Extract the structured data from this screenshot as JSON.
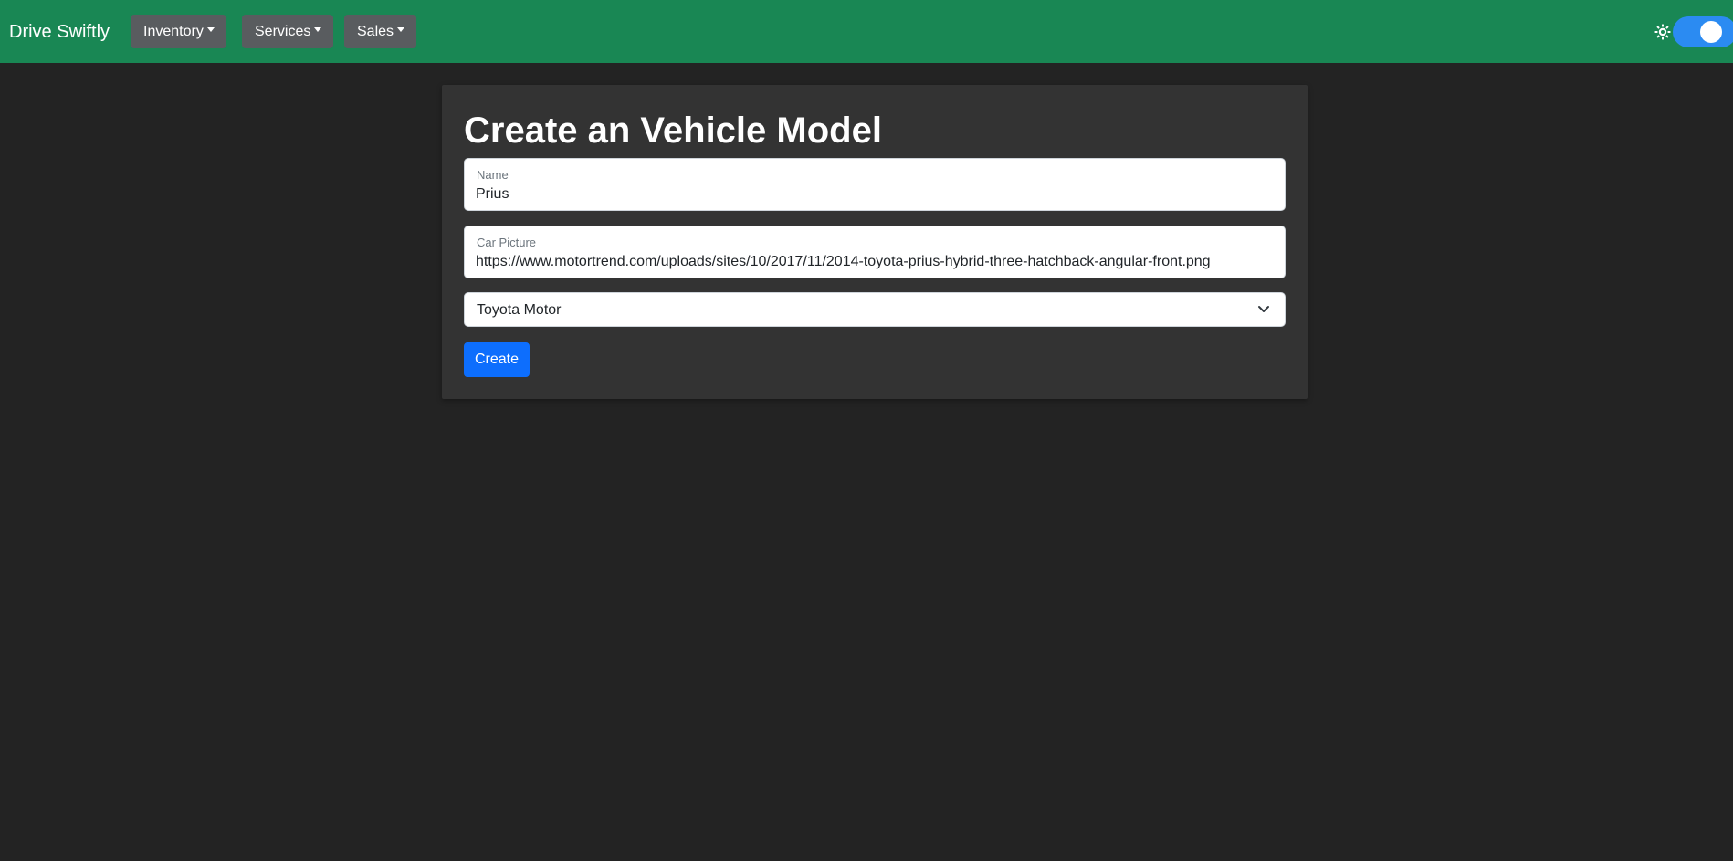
{
  "navbar": {
    "brand": "Drive Swiftly",
    "menus": [
      {
        "label": "Inventory"
      },
      {
        "label": "Services"
      },
      {
        "label": "Sales"
      }
    ],
    "theme_toggle": {
      "icon": "sun-icon",
      "on": true
    }
  },
  "form": {
    "title": "Create an Vehicle Model",
    "name": {
      "label": "Name",
      "value": "Prius"
    },
    "picture": {
      "label": "Car Picture",
      "value": "https://www.motortrend.com/uploads/sites/10/2017/11/2014-toyota-prius-hybrid-three-hatchback-angular-front.png"
    },
    "manufacturer": {
      "selected": "Toyota Motor"
    },
    "submit_label": "Create"
  },
  "colors": {
    "navbar": "#198754",
    "background": "#232323",
    "card": "#333333",
    "primary": "#0d6efd",
    "nav_button": "#595c5f",
    "toggle": "#2b8bf2"
  }
}
